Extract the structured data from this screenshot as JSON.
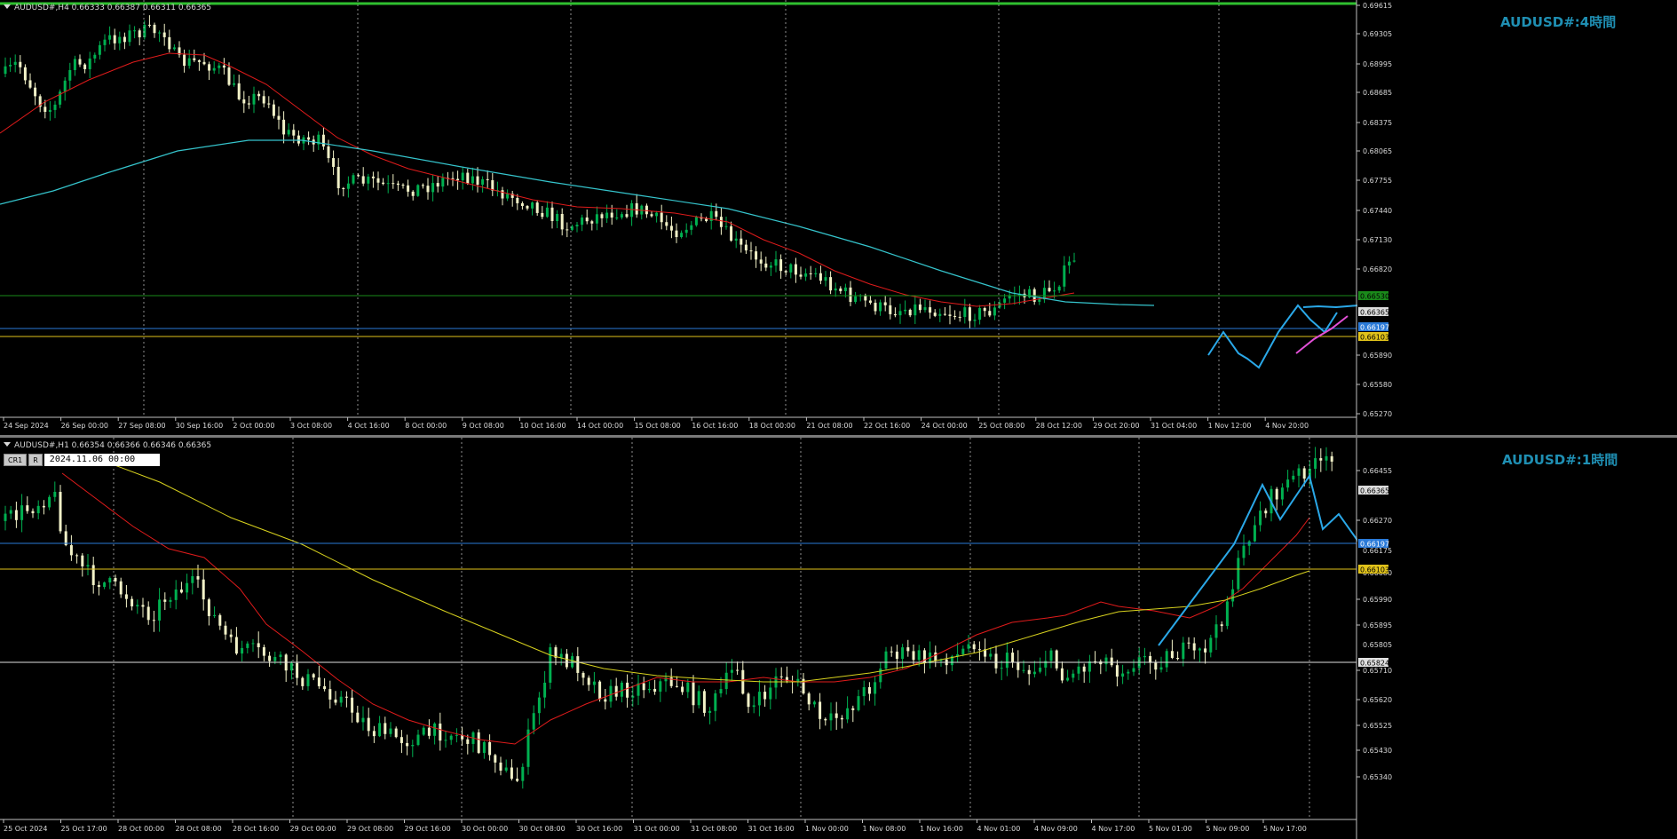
{
  "top": {
    "info": "AUDUSD#,H4  0.66333 0.66387 0.66311 0.66365",
    "title": "AUDUSD#:4時間",
    "axis_prices": [
      "0.69615",
      "0.69305",
      "0.68995",
      "0.68685",
      "0.68375",
      "0.68065",
      "0.67755",
      "0.67440",
      "0.67130",
      "0.66820",
      "0.66365",
      "0.65890",
      "0.65580",
      "0.65270"
    ],
    "tagged_prices": {
      "resistance": "0.66530",
      "current": "0.66365",
      "blue": "0.66197",
      "yellow": "0.66103"
    },
    "time_labels": [
      "24 Sep 2024",
      "26 Sep 00:00",
      "27 Sep 08:00",
      "30 Sep 16:00",
      "2 Oct 00:00",
      "3 Oct 08:00",
      "4 Oct 16:00",
      "8 Oct 00:00",
      "9 Oct 08:00",
      "10 Oct 16:00",
      "14 Oct 00:00",
      "15 Oct 08:00",
      "16 Oct 16:00",
      "18 Oct 00:00",
      "21 Oct 08:00",
      "22 Oct 16:00",
      "24 Oct 00:00",
      "25 Oct 08:00",
      "28 Oct 12:00",
      "29 Oct 20:00",
      "31 Oct 04:00",
      "1 Nov 12:00",
      "4 Nov 20:00"
    ]
  },
  "bottom": {
    "info": "AUDUSD#,H1  0.66354 0.66366 0.66346 0.66365",
    "title": "AUDUSD#:1時間",
    "toolbar": {
      "cr": "CR1",
      "r": "R",
      "date": "2024.11.06 00:00"
    },
    "axis_prices": [
      "0.66455",
      "0.66365",
      "0.66270",
      "0.66175",
      "0.66080",
      "0.65990",
      "0.65895",
      "0.65805",
      "0.65710",
      "0.65620",
      "0.65525",
      "0.65430",
      "0.65340"
    ],
    "tagged_prices": {
      "current": "0.66365",
      "blue": "0.66197",
      "yellow": "0.66103",
      "white": "0.65824"
    },
    "time_labels": [
      "25 Oct 2024",
      "25 Oct 17:00",
      "28 Oct 00:00",
      "28 Oct 08:00",
      "28 Oct 16:00",
      "29 Oct 00:00",
      "29 Oct 08:00",
      "29 Oct 16:00",
      "30 Oct 00:00",
      "30 Oct 08:00",
      "30 Oct 16:00",
      "31 Oct 00:00",
      "31 Oct 08:00",
      "31 Oct 16:00",
      "1 Nov 00:00",
      "1 Nov 08:00",
      "1 Nov 16:00",
      "4 Nov 01:00",
      "4 Nov 09:00",
      "4 Nov 17:00",
      "5 Nov 01:00",
      "5 Nov 09:00",
      "5 Nov 17:00"
    ]
  },
  "colors": {
    "bg": "#000000",
    "bull": "#00b050",
    "bear": "#f2f2c8",
    "grid": "#c0c0c0",
    "ma_red": "#e01b1b",
    "ma_cyan": "#35c4cc",
    "ma_yellow": "#d8d21e",
    "hline_green": "#1a8a1a",
    "hline_blue": "#2a7ad8",
    "hline_yellow": "#e0c21a",
    "hline_white": "#e0e0e0",
    "projection": "#2aa8e8",
    "pink": "#e24fd6",
    "title": "#1f8fb3"
  }
}
